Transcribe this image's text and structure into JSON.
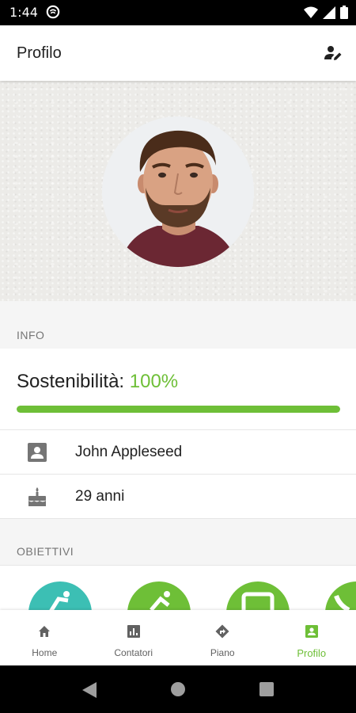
{
  "status_bar": {
    "time": "1:44"
  },
  "app_bar": {
    "title": "Profilo"
  },
  "sections": {
    "info": "INFO",
    "goals": "OBIETTIVI"
  },
  "sustainability": {
    "label": "Sostenibilità:",
    "value_text": "100%",
    "progress": 1.0
  },
  "info_rows": [
    {
      "icon": "contact-card-icon",
      "text": "John Appleseed"
    },
    {
      "icon": "cake-icon",
      "text": "29 anni"
    }
  ],
  "goals": [
    {
      "icon": "walking-icon",
      "color": "#3cbfb4"
    },
    {
      "icon": "cycling-icon",
      "color": "#6ebf37"
    },
    {
      "icon": "bus-icon",
      "color": "#6ebf37"
    },
    {
      "icon": "phone-icon",
      "color": "#6ebf37"
    }
  ],
  "bottom_nav": [
    {
      "label": "Home",
      "icon": "home-icon",
      "active": false
    },
    {
      "label": "Contatori",
      "icon": "stats-icon",
      "active": false
    },
    {
      "label": "Piano",
      "icon": "directions-icon",
      "active": false
    },
    {
      "label": "Profilo",
      "icon": "profile-card-icon",
      "active": true
    }
  ],
  "colors": {
    "accent": "#6ebf37",
    "teal": "#3cbfb4"
  }
}
